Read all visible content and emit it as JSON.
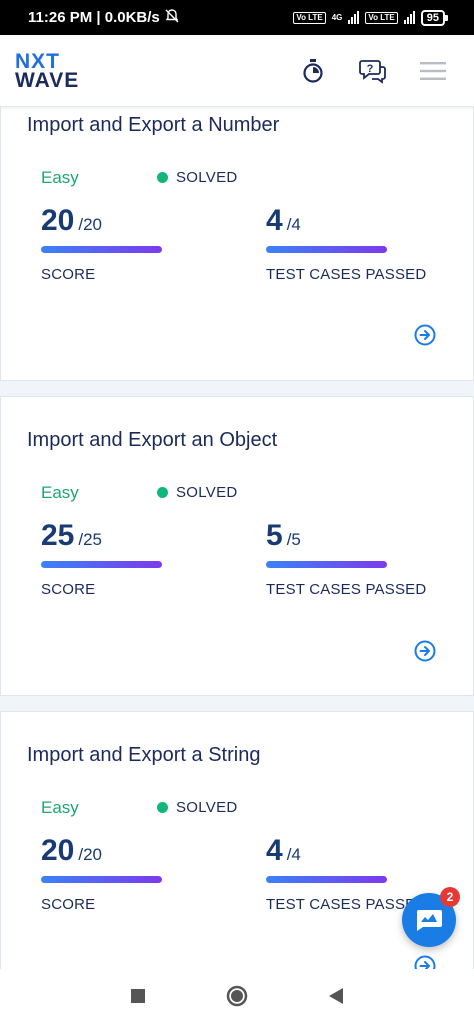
{
  "status_bar": {
    "time_speed": "11:26 PM | 0.0KB/s",
    "network_label": "4G",
    "volte_label_1": "Vo LTE",
    "volte_label_2": "Vo LTE",
    "battery": "95"
  },
  "header": {
    "logo_top": "NXT",
    "logo_bottom": "WAVE",
    "icons": [
      "timer-icon",
      "help-chat-icon",
      "hamburger-menu-icon"
    ]
  },
  "cards": [
    {
      "title": "Import and Export a Number",
      "difficulty": "Easy",
      "status": "SOLVED",
      "score": "20",
      "score_total": "/20",
      "score_label": "SCORE",
      "tests": "4",
      "tests_total": "/4",
      "tests_label": "TEST CASES PASSED"
    },
    {
      "title": "Import and Export an Object",
      "difficulty": "Easy",
      "status": "SOLVED",
      "score": "25",
      "score_total": "/25",
      "score_label": "SCORE",
      "tests": "5",
      "tests_total": "/5",
      "tests_label": "TEST CASES PASSED"
    },
    {
      "title": "Import and Export a String",
      "difficulty": "Easy",
      "status": "SOLVED",
      "score": "20",
      "score_total": "/20",
      "score_label": "SCORE",
      "tests": "4",
      "tests_total": "/4",
      "tests_label": "TEST CASES PASSED"
    }
  ],
  "chat": {
    "badge_count": "2"
  },
  "colors": {
    "easy": "#1fa670",
    "solved_dot": "#10b77a",
    "primary_dark": "#1b2a5b",
    "accent_blue": "#1a7de6",
    "badge_red": "#e53935"
  }
}
